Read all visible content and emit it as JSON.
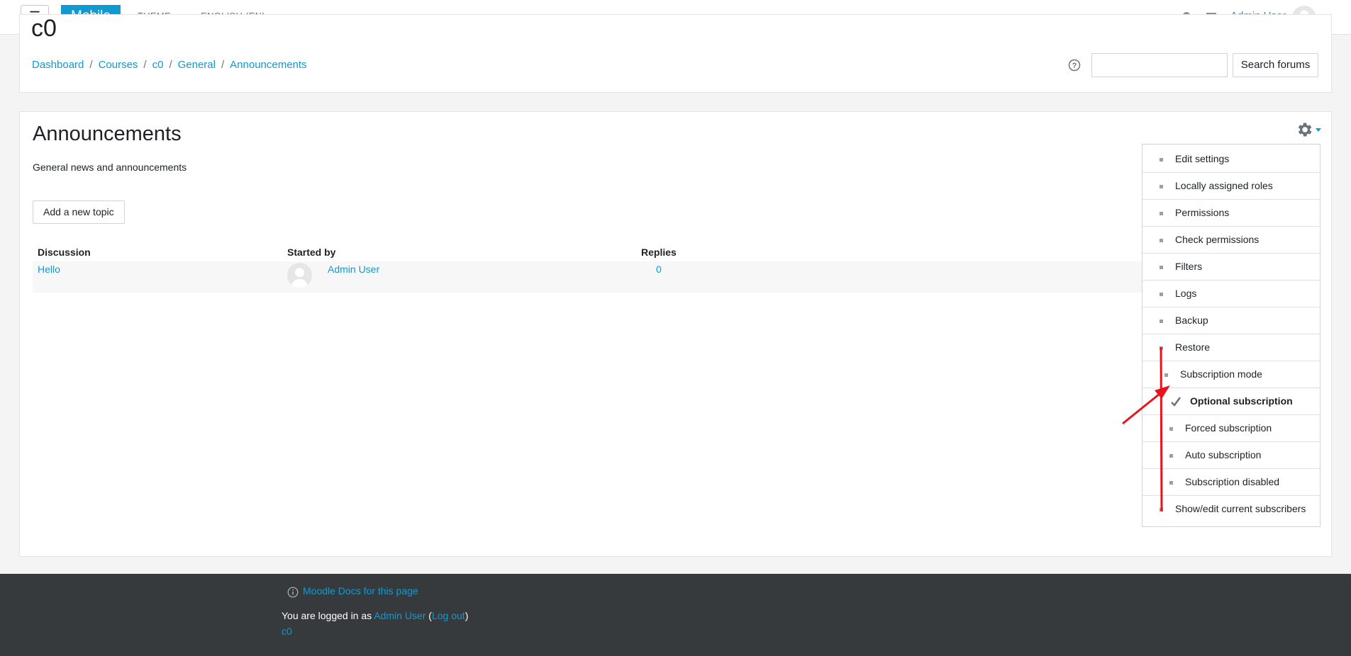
{
  "navbar": {
    "menu_icon": "☰",
    "brand": "Mobile",
    "theme_menu": "THEME",
    "language_menu": "ENGLISH (EN)",
    "notifications_icon": "bell-icon",
    "messages_icon": "chat-icon",
    "user_name": "Admin User"
  },
  "header": {
    "course_title": "c0",
    "breadcrumb": [
      "Dashboard",
      "Courses",
      "c0",
      "General",
      "Announcements"
    ],
    "search_placeholder": "",
    "search_button": "Search forums"
  },
  "forum": {
    "title": "Announcements",
    "intro": "General news and announcements",
    "add_topic_button": "Add a new topic",
    "columns": [
      "Discussion",
      "Started by",
      "Replies"
    ],
    "rows": [
      {
        "discussion": "Hello",
        "started_by": "Admin User",
        "replies": "0"
      }
    ]
  },
  "settings_menu": {
    "items": [
      {
        "label": "Edit settings"
      },
      {
        "label": "Locally assigned roles"
      },
      {
        "label": "Permissions"
      },
      {
        "label": "Check permissions"
      },
      {
        "label": "Filters"
      },
      {
        "label": "Logs"
      },
      {
        "label": "Backup"
      },
      {
        "label": "Restore"
      },
      {
        "label": "Subscription mode"
      },
      {
        "label": "Optional subscription",
        "checked": true
      },
      {
        "label": "Forced subscription"
      },
      {
        "label": "Auto subscription"
      },
      {
        "label": "Subscription disabled"
      },
      {
        "label": "Show/edit current subscribers"
      }
    ]
  },
  "footer": {
    "docs_link": "Moodle Docs for this page",
    "logged_in_prefix": "You are logged in as ",
    "logged_in_user": "Admin User",
    "open_paren": " (",
    "logout": "Log out",
    "close_paren": ")",
    "course_link": "c0"
  },
  "colors": {
    "accent": "#0f9ad1",
    "footer_bg": "#373a3c",
    "annotation": "#e8141c"
  }
}
